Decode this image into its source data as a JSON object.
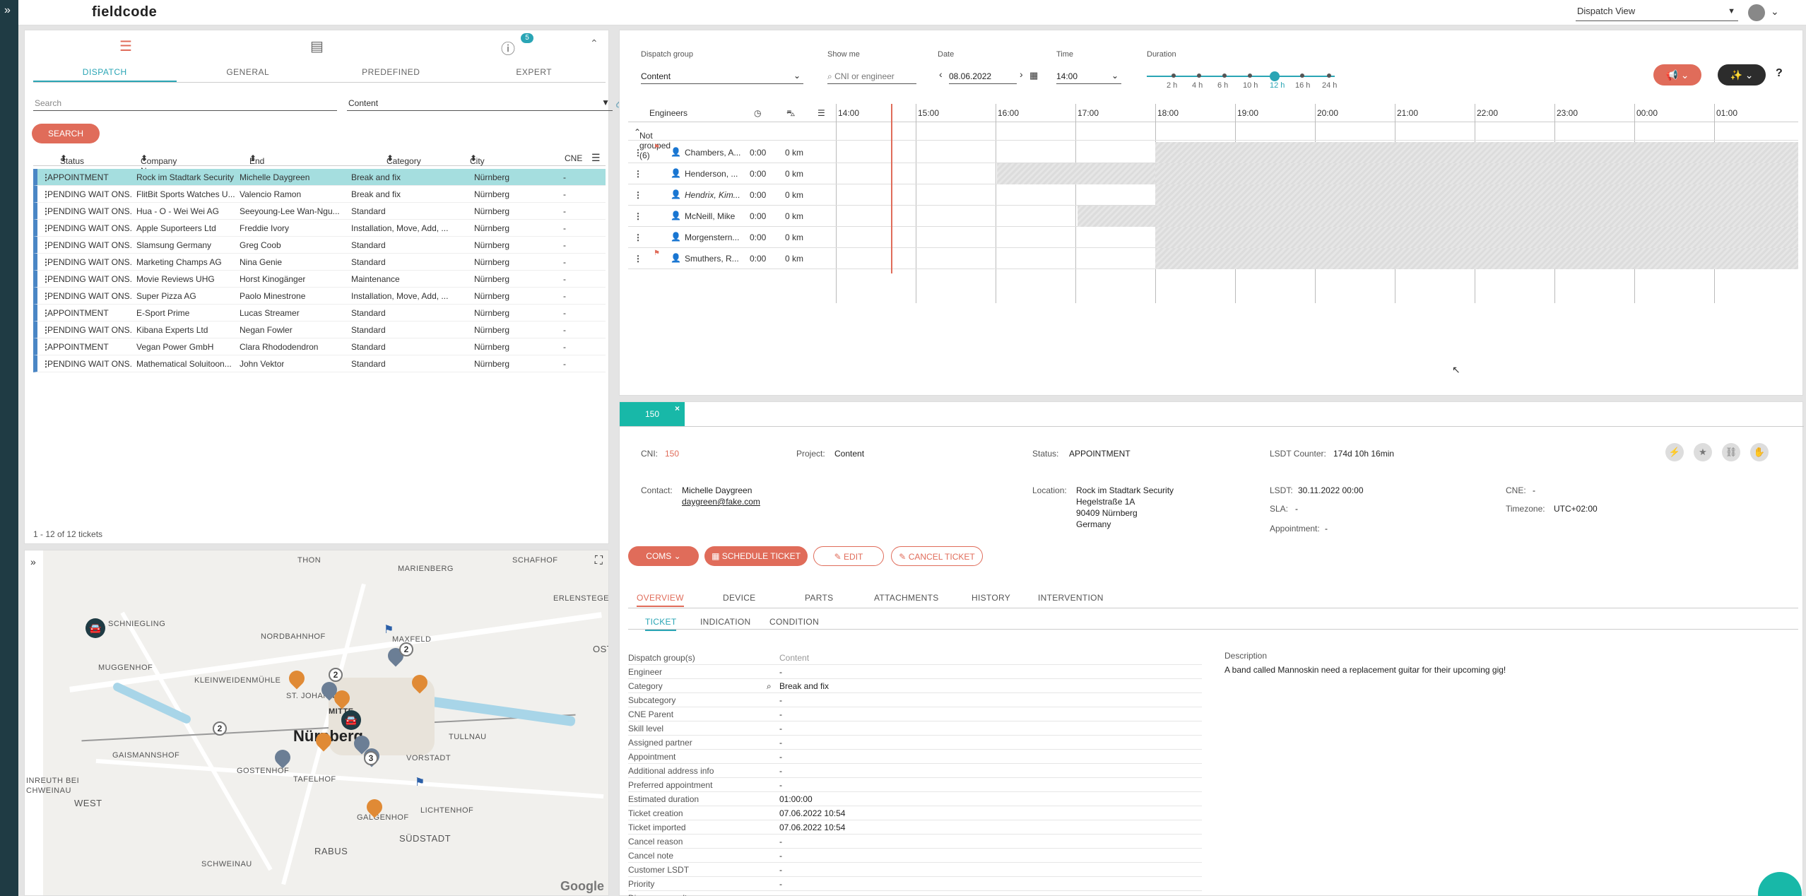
{
  "app": {
    "logo": "fieldcode",
    "view": "Dispatch View"
  },
  "ticket_list": {
    "info_badge": "5",
    "tabs": [
      "DISPATCH",
      "GENERAL",
      "PREDEFINED",
      "EXPERT"
    ],
    "search_placeholder": "Search",
    "content_filter": "Content",
    "search_button": "SEARCH",
    "columns": [
      "Status",
      "Company Name",
      "End user name",
      "Category",
      "City",
      "CNE"
    ],
    "rows": [
      [
        "APPOINTMENT",
        "Rock im Stadtark Security",
        "Michelle Daygreen",
        "Break and fix",
        "Nürnberg",
        "-"
      ],
      [
        "PENDING WAIT ONS...",
        "FlitBit Sports Watches U...",
        "Valencio Ramon",
        "Break and fix",
        "Nürnberg",
        "-"
      ],
      [
        "PENDING WAIT ONS...",
        "Hua - O - Wei Wei AG",
        "Seeyoung-Lee Wan-Ngu...",
        "Standard",
        "Nürnberg",
        "-"
      ],
      [
        "PENDING WAIT ONS...",
        "Apple Suporteers Ltd",
        "Freddie Ivory",
        "Installation, Move, Add, ...",
        "Nürnberg",
        "-"
      ],
      [
        "PENDING WAIT ONS...",
        "Slamsung Germany",
        "Greg Coob",
        "Standard",
        "Nürnberg",
        "-"
      ],
      [
        "PENDING WAIT ONS...",
        "Marketing Champs AG",
        "Nina Genie",
        "Standard",
        "Nürnberg",
        "-"
      ],
      [
        "PENDING WAIT ONS...",
        "Movie Reviews UHG",
        "Horst Kinogänger",
        "Maintenance",
        "Nürnberg",
        "-"
      ],
      [
        "PENDING WAIT ONS...",
        "Super Pizza AG",
        "Paolo Minestrone",
        "Installation, Move, Add, ...",
        "Nürnberg",
        "-"
      ],
      [
        "APPOINTMENT",
        "E-Sport Prime",
        "Lucas Streamer",
        "Standard",
        "Nürnberg",
        "-"
      ],
      [
        "PENDING WAIT ONS...",
        "Kibana Experts Ltd",
        "Negan Fowler",
        "Standard",
        "Nürnberg",
        "-"
      ],
      [
        "APPOINTMENT",
        "Vegan Power GmbH",
        "Clara Rhododendron",
        "Standard",
        "Nürnberg",
        "-"
      ],
      [
        "PENDING WAIT ONS...",
        "Mathematical Soluitoon...",
        "John Vektor",
        "Standard",
        "Nürnberg",
        "-"
      ]
    ],
    "footer": "1 - 12 of 12 tickets"
  },
  "map": {
    "labels": [
      "THON",
      "MARIENBERG",
      "SCHAFHOF",
      "ERLENSTEGEN",
      "SCHNIEGLING",
      "NORDBAHNHOF",
      "MAXFELD",
      "KLEINWEIDENMÜHLE",
      "ST. JOHANNIS",
      "MITTE",
      "GAISMANNSHOF",
      "GOSTENHOF",
      "TAFELHOF",
      "VORSTADT",
      "TULLNAU",
      "MUGGENHOF",
      "RABUS",
      "SCHWEINAU",
      "GALGENHOF",
      "SÜDSTADT",
      "LICHTENHOF",
      "WEST",
      "INREUTH BEI",
      "CHWEINAU",
      "OST"
    ],
    "city": "Nürnberg",
    "clusters": [
      "2",
      "2",
      "2",
      "3"
    ],
    "attribution": "Google"
  },
  "dispatch": {
    "dispatch_group_label": "Dispatch group",
    "dispatch_group": "Content",
    "show_me_label": "Show me",
    "show_me_placeholder": "CNI or engineer",
    "date_label": "Date",
    "date": "08.06.2022",
    "time_label": "Time",
    "time": "14:00",
    "duration_label": "Duration",
    "durations": [
      "2 h",
      "4 h",
      "6 h",
      "10 h",
      "12 h",
      "16 h",
      "24 h"
    ],
    "selected_duration": "12 h",
    "engineers_label": "Engineers",
    "hours": [
      "14:00",
      "15:00",
      "16:00",
      "17:00",
      "18:00",
      "19:00",
      "20:00",
      "21:00",
      "22:00",
      "23:00",
      "00:00",
      "01:00"
    ],
    "group": "Not grouped (6)",
    "engineers": [
      {
        "name": "Chambers, A...",
        "time": "0:00",
        "km": "0 km"
      },
      {
        "name": "Henderson, ...",
        "time": "0:00",
        "km": "0 km"
      },
      {
        "name": "Hendrix, Kim...",
        "time": "0:00",
        "km": "0 km"
      },
      {
        "name": "McNeill, Mike",
        "time": "0:00",
        "km": "0 km"
      },
      {
        "name": "Morgenstern...",
        "time": "0:00",
        "km": "0 km"
      },
      {
        "name": "Smuthers, R...",
        "time": "0:00",
        "km": "0 km"
      }
    ]
  },
  "detail": {
    "tab": "150",
    "cni_label": "CNI:",
    "cni": "150",
    "project_label": "Project:",
    "project": "Content",
    "status_label": "Status:",
    "status": "APPOINTMENT",
    "lsdt_counter_label": "LSDT Counter:",
    "lsdt_counter": "174d 10h 16min",
    "contact_label": "Contact:",
    "contact_name": "Michelle Daygreen",
    "contact_email": "daygreen@fake.com",
    "location_label": "Location:",
    "location": [
      "Rock im Stadtark Security",
      "Hegelstraße 1A",
      "90409 Nürnberg",
      "Germany"
    ],
    "lsdt_label": "LSDT:",
    "lsdt": "30.11.2022 00:00",
    "sla_label": "SLA:",
    "sla": "-",
    "appointment_label": "Appointment:",
    "appointment": "-",
    "cne_label": "CNE:",
    "cne": "-",
    "timezone_label": "Timezone:",
    "timezone": "UTC+02:00",
    "buttons": {
      "coms": "COMS",
      "schedule": "SCHEDULE TICKET",
      "edit": "EDIT",
      "cancel": "CANCEL TICKET"
    },
    "tabs": [
      "OVERVIEW",
      "DEVICE",
      "PARTS",
      "ATTACHMENTS",
      "HISTORY",
      "INTERVENTION"
    ],
    "subtabs": [
      "TICKET",
      "INDICATION",
      "CONDITION"
    ],
    "fields": [
      [
        "Dispatch group(s)",
        "Content"
      ],
      [
        "Engineer",
        "-"
      ],
      [
        "Category",
        "Break and fix"
      ],
      [
        "Subcategory",
        "-"
      ],
      [
        "CNE Parent",
        "-"
      ],
      [
        "Skill level",
        "-"
      ],
      [
        "Assigned partner",
        "-"
      ],
      [
        "Appointment",
        "-"
      ],
      [
        "Additional address info",
        "-"
      ],
      [
        "Preferred appointment",
        "-"
      ],
      [
        "Estimated duration",
        "01:00:00"
      ],
      [
        "Ticket creation",
        "07.06.2022 10:54"
      ],
      [
        "Ticket imported",
        "07.06.2022 10:54"
      ],
      [
        "Cancel reason",
        "-"
      ],
      [
        "Cancel note",
        "-"
      ],
      [
        "Customer LSDT",
        "-"
      ],
      [
        "Priority",
        "-"
      ],
      [
        "Diagnose result",
        "-"
      ]
    ],
    "description_label": "Description",
    "description": "A band called Mannoskin need a replacement guitar for their upcoming gig!"
  }
}
